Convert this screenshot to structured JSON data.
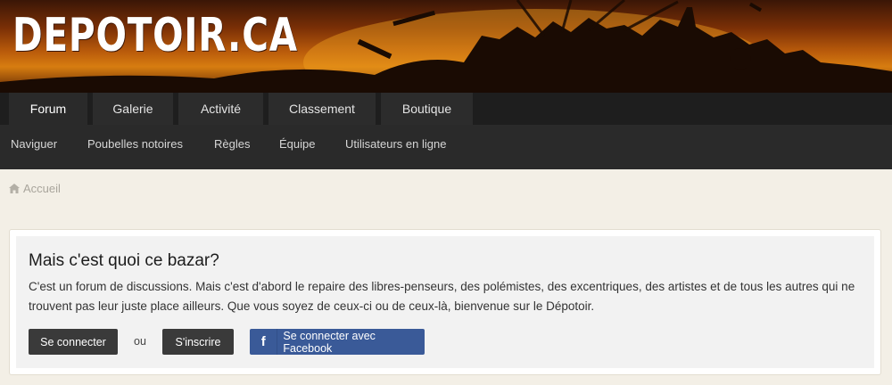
{
  "header": {
    "logo_text": "DEPOTOIR.CA"
  },
  "main_nav": {
    "tabs": [
      {
        "label": "Forum",
        "active": true
      },
      {
        "label": "Galerie",
        "active": false
      },
      {
        "label": "Activité",
        "active": false
      },
      {
        "label": "Classement",
        "active": false
      },
      {
        "label": "Boutique",
        "active": false
      }
    ]
  },
  "sub_nav": {
    "items": [
      "Naviguer",
      "Poubelles notoires",
      "Règles",
      "Équipe",
      "Utilisateurs en ligne"
    ]
  },
  "breadcrumb": {
    "home_label": "Accueil",
    "icon": "home-icon"
  },
  "intro": {
    "title": "Mais c'est quoi ce bazar?",
    "description": "C'est un forum de discussions. Mais c'est d'abord le repaire des libres-penseurs, des polémistes, des excentriques, des artistes et de tous les autres qui ne trouvent pas leur juste place ailleurs. Que vous soyez de ceux-ci ou de ceux-là, bienvenue sur le Dépotoir.",
    "login_label": "Se connecter",
    "or_label": "ou",
    "register_label": "S'inscrire",
    "facebook_label": "Se connecter avec Facebook",
    "facebook_icon": "facebook-icon"
  },
  "colors": {
    "banner_orange": "#d77d10",
    "nav_bg": "#1e1e1e",
    "button_dark": "#3a3a3a",
    "facebook_blue": "#3a5a98",
    "page_bg": "#f3efe6"
  }
}
